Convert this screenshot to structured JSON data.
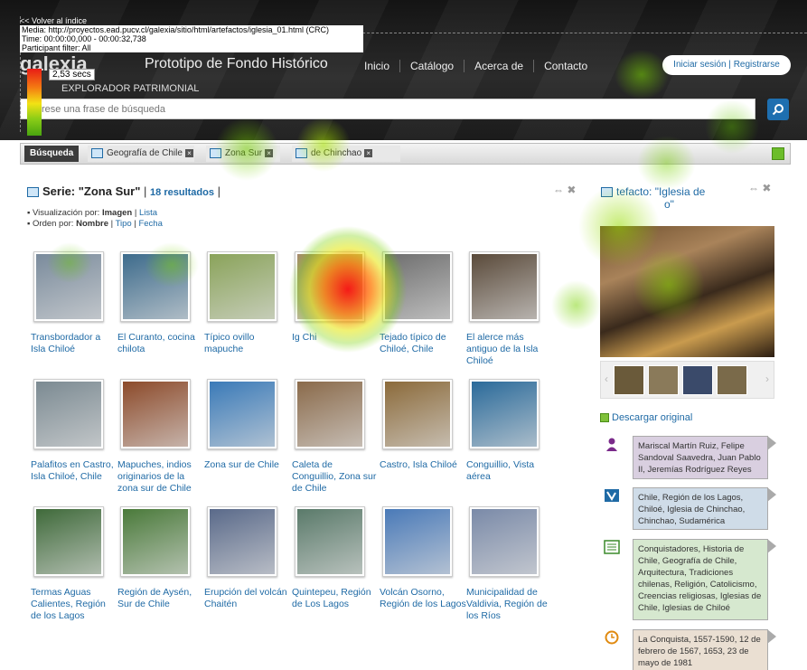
{
  "tracker": {
    "back_link": "<< Volver al índice",
    "media": "Media: http://proyectos.ead.pucv.cl/galexia/sitio/html/artefactos/iglesia_01.html (CRC)",
    "time": "Time: 00:00:00,000 - 00:00:32,738",
    "filter": "Participant filter: All",
    "scale_label": "2,53 secs"
  },
  "header": {
    "logo": "galexia",
    "title": "Prototipo de Fondo Histórico",
    "subtitle": "EXPLORADOR PATRIMONIAL",
    "nav": [
      "Inicio",
      "Catálogo",
      "Acerca de",
      "Contacto"
    ],
    "login": "Iniciar sesión",
    "register": "Registrarse",
    "search_placeholder": "rese una frase de búsqueda"
  },
  "breadcrumbs": {
    "first": "Búsqueda",
    "items": [
      "Geografía de Chile",
      "Zona Sur",
      "Chinchao"
    ]
  },
  "serie": {
    "label": "Serie: \"Zona Sur\"",
    "count": "18 resultados",
    "sep": "|",
    "view_label": "Visualización por:",
    "view_active": "Imagen",
    "view_other": "Lista",
    "order_label": "Orden por:",
    "order_active": "Nombre",
    "order_tipo": "Tipo",
    "order_fecha": "Fecha"
  },
  "grid": [
    {
      "caption": "Transbordador a Isla Chiloé",
      "color": "#7a8b9c"
    },
    {
      "caption": "El Curanto, cocina chilota",
      "color": "#3d6b8c"
    },
    {
      "caption": "Típico ovillo mapuche",
      "color": "#8aa35a"
    },
    {
      "caption": "Ig Chi",
      "color": "#a58a6a"
    },
    {
      "caption": "Tejado típico de Chiloé, Chile",
      "color": "#6e6e6e"
    },
    {
      "caption": "El alerce más antiguo de la Isla Chiloé",
      "color": "#5a4a3a"
    },
    {
      "caption": "Palafitos en Castro, Isla Chiloé, Chile",
      "color": "#7b8a92"
    },
    {
      "caption": "Mapuches, indios originarios de la zona sur de Chile",
      "color": "#8c4a2a"
    },
    {
      "caption": "Zona sur de Chile",
      "color": "#3a7ab8"
    },
    {
      "caption": "Caleta de Conguillio, Zona sur de Chile",
      "color": "#8a6a4a"
    },
    {
      "caption": "Castro, Isla Chiloé",
      "color": "#8b6a3a"
    },
    {
      "caption": "Conguillio, Vista aérea",
      "color": "#2a6a9a"
    },
    {
      "caption": "Termas Aguas Calientes, Región de los Lagos",
      "color": "#3f6a3a"
    },
    {
      "caption": "Región de Aysén, Sur de Chile",
      "color": "#4a7a3a"
    },
    {
      "caption": "Erupción del volcán Chaitén",
      "color": "#5a6a8a"
    },
    {
      "caption": "Quintepeu, Región de Los Lagos",
      "color": "#5a7a6a"
    },
    {
      "caption": "Volcán Osorno, Región de los Lagos",
      "color": "#4a7ab8"
    },
    {
      "caption": "Municipalidad de Valdivia, Región de los Ríos",
      "color": "#7a8aa8"
    }
  ],
  "side": {
    "title_prefix": "tefacto: \"Iglesia de",
    "title_suffix": "o\"",
    "download": "Descargar original",
    "people": "Mariscal Martín Ruiz, Felipe Sandoval Saavedra, Juan Pablo II, Jeremías Rodríguez Reyes",
    "places": "Chile, Región de los Lagos, Chiloé, Iglesia de Chinchao, Chinchao, Sudamérica",
    "topics": "Conquistadores, Historia de Chile, Geografía de Chile, Arquitectura, Tradiciones chilenas, Religión, Catolicismo, Creencias religiosas, Iglesias de Chile, Iglesias de Chiloé",
    "dates": "La Conquista, 1557-1590, 12 de febrero de 1567, 1653, 23 de mayo de 1981",
    "people_color": "#d9cfe0",
    "places_color": "#cfdce8",
    "topics_color": "#d6e8cf",
    "dates_color": "#eadfd2"
  }
}
